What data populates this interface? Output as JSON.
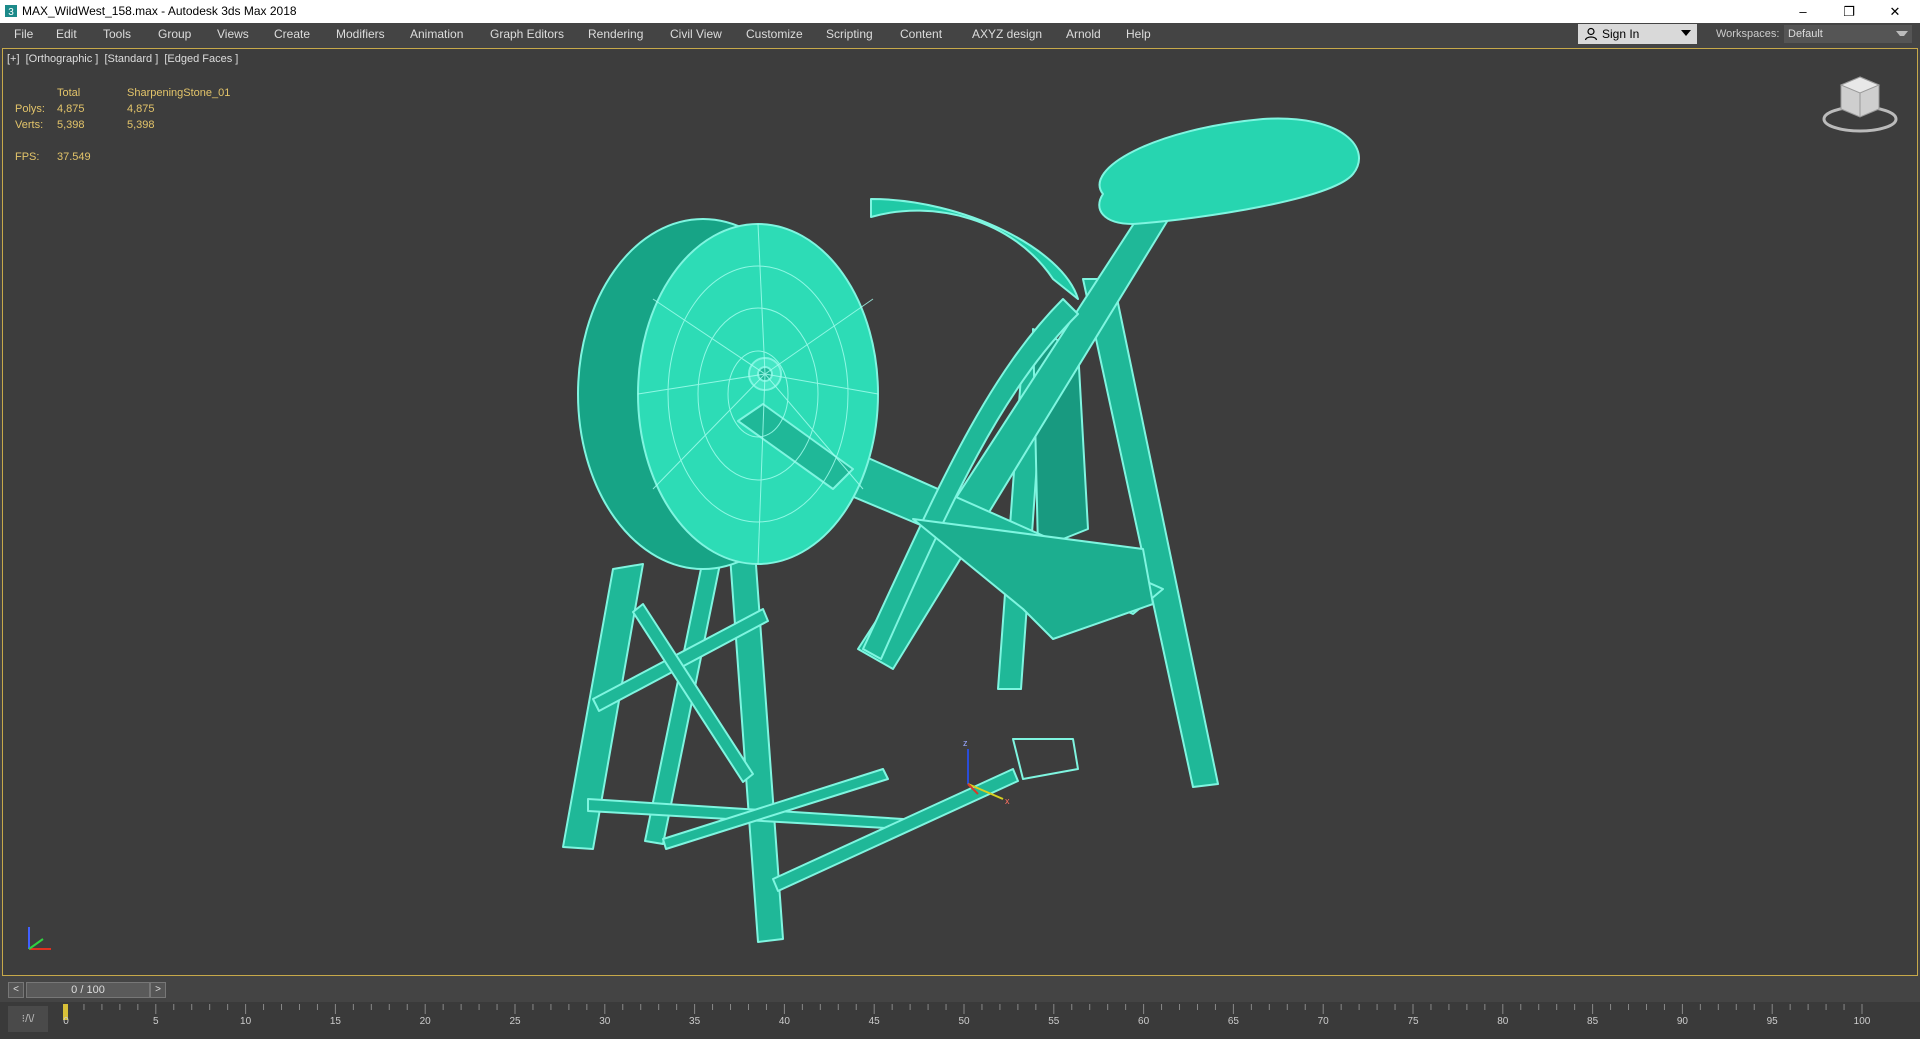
{
  "window": {
    "title": "MAX_WildWest_158.max - Autodesk 3ds Max 2018",
    "controls": [
      "–",
      "❐",
      "✕"
    ]
  },
  "menu": [
    "File",
    "Edit",
    "Tools",
    "Group",
    "Views",
    "Create",
    "Modifiers",
    "Animation",
    "Graph Editors",
    "Rendering",
    "Civil View",
    "Customize",
    "Scripting",
    "Content",
    "AXYZ design",
    "Arnold",
    "Help"
  ],
  "signin": {
    "label": "Sign In"
  },
  "workspaces": {
    "label": "Workspaces:",
    "value": "Default"
  },
  "viewport": {
    "labels": [
      "[+]",
      "[Orthographic ]",
      "[Standard ]",
      "[Edged Faces ]"
    ],
    "stats": {
      "header": [
        "",
        "Total",
        "SharpeningStone_01"
      ],
      "polys": [
        "Polys:",
        "4,875",
        "4,875"
      ],
      "verts": [
        "Verts:",
        "5,398",
        "5,398"
      ],
      "fps": [
        "FPS:",
        "37.549"
      ]
    },
    "gizmo": {
      "x": "x",
      "z": "z"
    },
    "model_color": "#2ee8c0",
    "frame_color": "#c7a94a"
  },
  "timeslider": {
    "value": "0 / 100",
    "prev": "<",
    "next": ">"
  },
  "trackbar": {
    "labels": [
      "0",
      "5",
      "10",
      "15",
      "20",
      "25",
      "30",
      "35",
      "40",
      "45",
      "50",
      "55",
      "60",
      "65",
      "70",
      "75",
      "80",
      "85",
      "90",
      "95",
      "100"
    ],
    "icon": "⁝/\\/"
  }
}
